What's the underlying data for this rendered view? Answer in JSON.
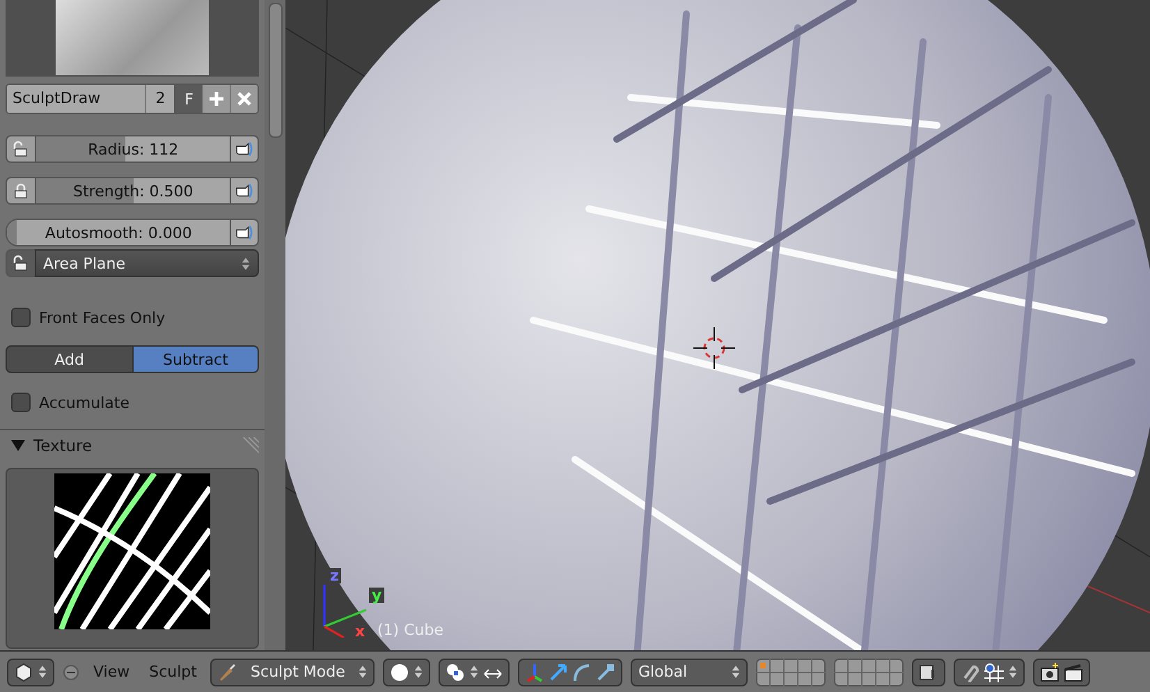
{
  "brush": {
    "name": "SculptDraw",
    "users": "2",
    "fake_user_label": "F",
    "fake_user": true
  },
  "sliders": [
    {
      "kind": "lock",
      "label": "Radius: 112",
      "level": 0.46,
      "locked": false
    },
    {
      "kind": "lock",
      "label": "Strength: 0.500",
      "level": 0.5,
      "locked": true
    },
    {
      "kind": "plain",
      "label": "Autosmooth: 0.000",
      "level": 0.0
    }
  ],
  "stroke_method": {
    "label": "Area Plane",
    "locked": false
  },
  "front_faces": {
    "label": "Front Faces Only",
    "checked": false
  },
  "direction": [
    {
      "label": "Add",
      "selected": false
    },
    {
      "label": "Subtract",
      "selected": true
    }
  ],
  "accumulate": {
    "label": "Accumulate",
    "checked": false
  },
  "texture_panel": {
    "title": "Texture",
    "expanded": true
  },
  "viewport": {
    "object_label": "(1) Cube",
    "axes": [
      "x",
      "y",
      "z"
    ]
  },
  "header": {
    "menus": [
      "View",
      "Sculpt"
    ],
    "mode": "Sculpt Mode",
    "orientation": "Global"
  }
}
